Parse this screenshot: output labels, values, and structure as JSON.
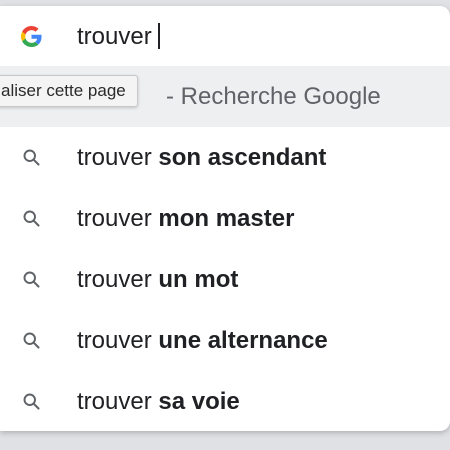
{
  "omnibox": {
    "input_value": "trouver",
    "provider_icon": "google-g-icon",
    "highlight_suffix": "- Recherche Google",
    "tooltip": "aliser cette page"
  },
  "suggestions": [
    {
      "query": "trouver",
      "completion": "son ascendant",
      "icon": "search-icon"
    },
    {
      "query": "trouver",
      "completion": "mon master",
      "icon": "search-icon"
    },
    {
      "query": "trouver",
      "completion": "un mot",
      "icon": "search-icon"
    },
    {
      "query": "trouver",
      "completion": "une alternance",
      "icon": "search-icon"
    },
    {
      "query": "trouver",
      "completion": "sa voie",
      "icon": "search-icon"
    }
  ],
  "colors": {
    "google_blue": "#4285F4",
    "google_red": "#EA4335",
    "google_yellow": "#FBBC05",
    "google_green": "#34A853",
    "highlight_bg": "#eeeff1"
  }
}
